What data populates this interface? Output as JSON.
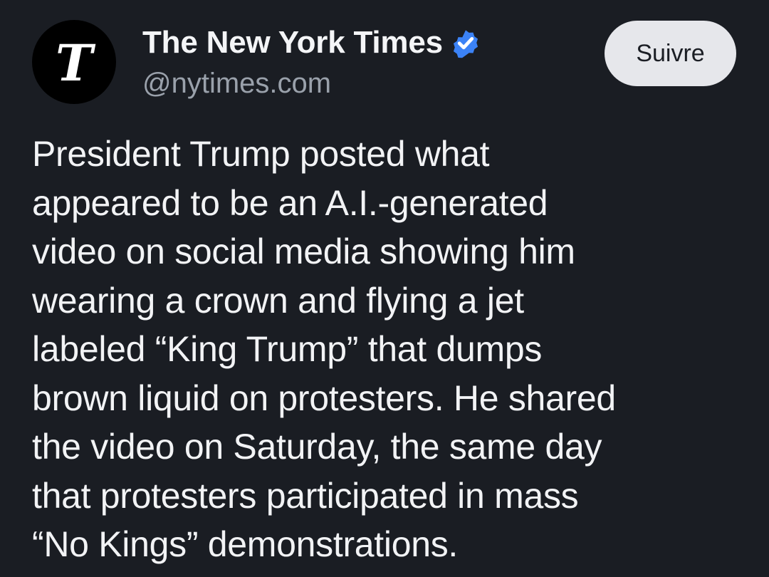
{
  "author": {
    "name": "The New York Times",
    "handle": "@nytimes.com",
    "avatar_glyph": "ᵗ",
    "avatar_letter": "T",
    "verified": true,
    "verified_icon": "verified-check-icon",
    "verified_color": "#3b82f6"
  },
  "follow_button": {
    "label": "Suivre"
  },
  "post": {
    "text": "President Trump posted what\nappeared to be an A.I.-generated\nvideo on social media showing him\nwearing a crown and flying a jet\nlabeled “King Trump” that dumps\nbrown liquid on protesters. He shared\nthe video on Saturday, the same day\nthat protesters participated in mass\n“No Kings” demonstrations."
  },
  "colors": {
    "background": "#1a1d23",
    "button_bg": "#e6e7eb",
    "handle_text": "#9aa1ab"
  }
}
